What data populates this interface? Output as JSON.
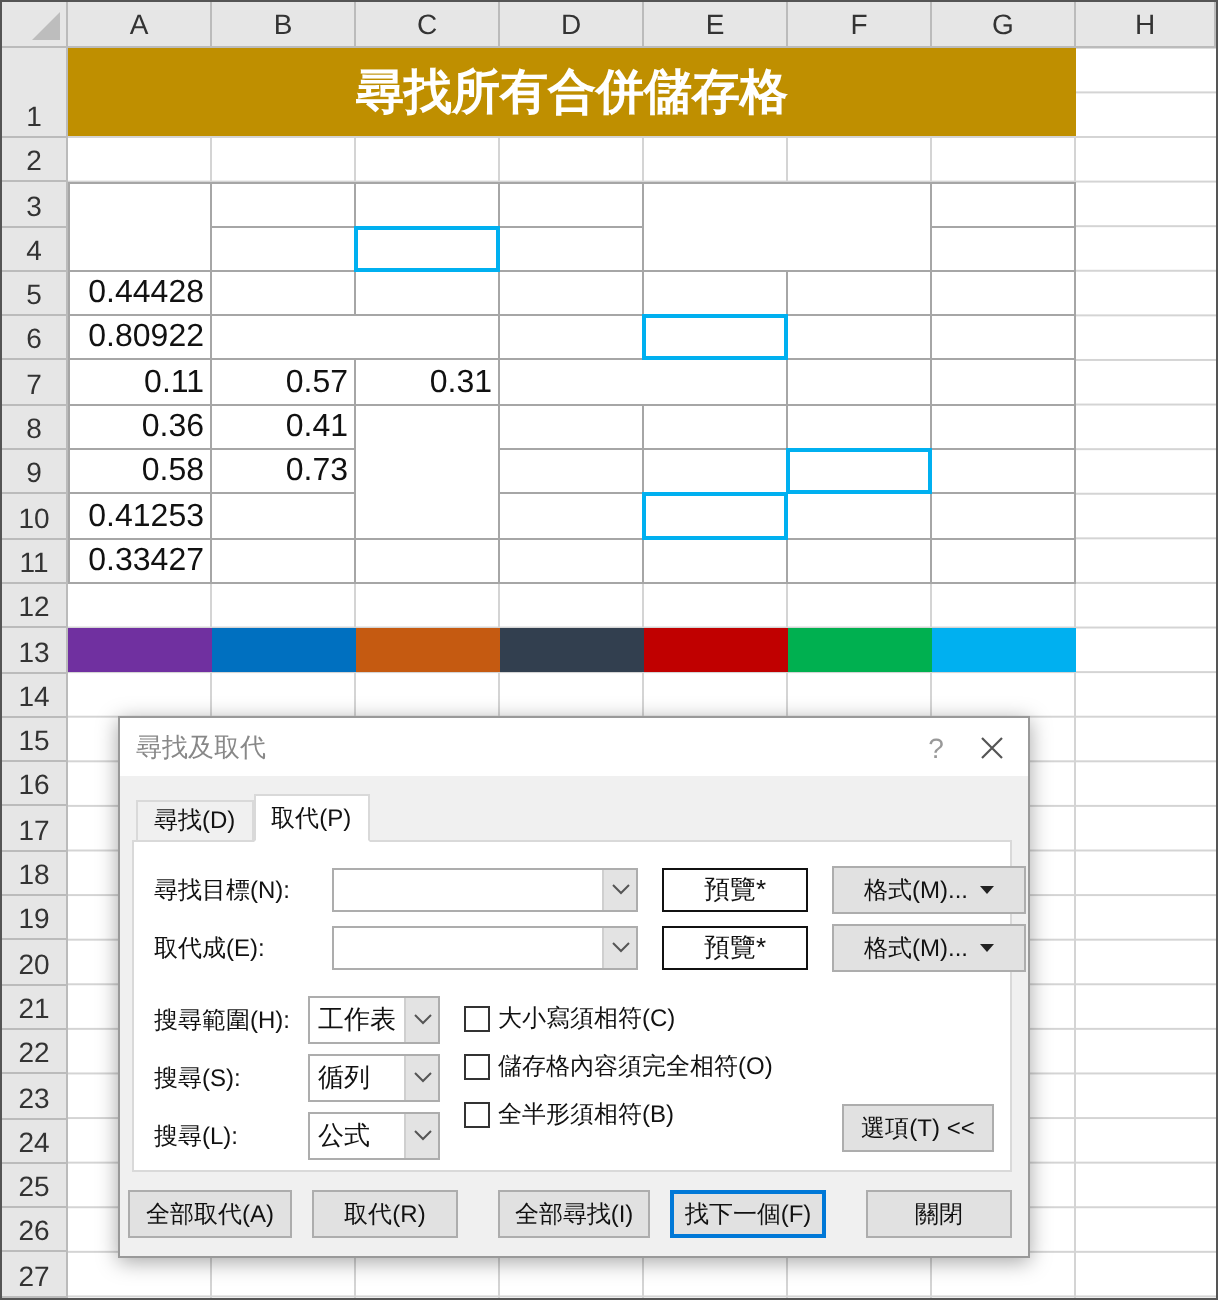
{
  "sheet": {
    "columns": [
      "A",
      "B",
      "C",
      "D",
      "E",
      "F",
      "G",
      "H"
    ],
    "rows": [
      "1",
      "2",
      "3",
      "4",
      "5",
      "6",
      "7",
      "8",
      "9",
      "10",
      "11",
      "12",
      "13",
      "14",
      "15",
      "16",
      "17",
      "18",
      "19",
      "20",
      "21",
      "22",
      "23",
      "24",
      "25",
      "26",
      "27"
    ],
    "title": "尋找所有合併儲存格",
    "cells": [
      {
        "highlighted": false
      },
      {
        "highlighted": false
      },
      {
        "highlighted": false
      },
      {
        "highlighted": false
      },
      {
        "highlighted": false
      },
      {
        "highlighted": false
      },
      {
        "highlighted": false
      },
      {
        "highlighted": true
      },
      {
        "highlighted": false
      },
      {
        "highlighted": false
      },
      {
        "value": "0.44428",
        "highlighted": false
      },
      {
        "highlighted": false
      },
      {
        "highlighted": false
      },
      {
        "highlighted": false
      },
      {
        "highlighted": false
      },
      {
        "highlighted": false
      },
      {
        "highlighted": false
      },
      {
        "value": "0.80922",
        "highlighted": false
      },
      {
        "highlighted": false
      },
      {
        "highlighted": false
      },
      {
        "highlighted": true
      },
      {
        "highlighted": false
      },
      {
        "highlighted": false
      },
      {
        "value": "0.11",
        "highlighted": false
      },
      {
        "value": "0.57",
        "highlighted": false
      },
      {
        "value": "0.31",
        "highlighted": false
      },
      {
        "highlighted": false
      },
      {
        "highlighted": false
      },
      {
        "highlighted": false
      },
      {
        "value": "0.36",
        "highlighted": false
      },
      {
        "value": "0.41",
        "highlighted": false
      },
      {
        "highlighted": false
      },
      {
        "highlighted": false
      },
      {
        "highlighted": false
      },
      {
        "highlighted": false
      },
      {
        "highlighted": false
      },
      {
        "value": "0.58",
        "highlighted": false
      },
      {
        "value": "0.73",
        "highlighted": false
      },
      {
        "highlighted": false
      },
      {
        "highlighted": false
      },
      {
        "highlighted": true
      },
      {
        "highlighted": false
      },
      {
        "value": "0.41253",
        "highlighted": false
      },
      {
        "highlighted": false
      },
      {
        "highlighted": false
      },
      {
        "highlighted": true
      },
      {
        "highlighted": false
      },
      {
        "highlighted": false
      },
      {
        "value": "0.33427",
        "highlighted": false
      },
      {
        "highlighted": false
      },
      {
        "highlighted": false
      },
      {
        "highlighted": false
      },
      {
        "highlighted": false
      },
      {
        "highlighted": false
      },
      {
        "highlighted": false
      }
    ],
    "color_row": [
      {
        "color": "#7030a0"
      },
      {
        "color": "#0070c0"
      },
      {
        "color": "#c55a11"
      },
      {
        "color": "#323f4f"
      },
      {
        "color": "#c00000"
      },
      {
        "color": "#00b050"
      },
      {
        "color": "#00b0f0"
      }
    ]
  },
  "dialog": {
    "title": "尋找及取代",
    "help": "?",
    "tabs": [
      {
        "label": "尋找(D)",
        "selected": false
      },
      {
        "label": "取代(P)",
        "selected": true
      }
    ],
    "fields": [
      {
        "label": "尋找目標(N):",
        "preview": "預覽*",
        "format_button": "格式(M)..."
      },
      {
        "label": "取代成(E):",
        "preview": "預覽*",
        "format_button": "格式(M)..."
      }
    ],
    "options": [
      {
        "label": "搜尋範圍(H):",
        "value": "工作表"
      },
      {
        "label": "搜尋(S):",
        "value": "循列"
      },
      {
        "label": "搜尋(L):",
        "value": "公式"
      }
    ],
    "checkboxes": [
      {
        "label": "大小寫須相符(C)",
        "checked": false
      },
      {
        "label": "儲存格內容須完全相符(O)",
        "checked": false
      },
      {
        "label": "全半形須相符(B)",
        "checked": false
      }
    ],
    "options_button": "選項(T) <<",
    "buttons": [
      {
        "label": "全部取代(A)",
        "default": false
      },
      {
        "label": "取代(R)",
        "default": false
      },
      {
        "label": "全部尋找(I)",
        "default": false
      },
      {
        "label": "找下一個(F)",
        "default": true
      },
      {
        "label": "關閉",
        "default": false
      }
    ]
  }
}
